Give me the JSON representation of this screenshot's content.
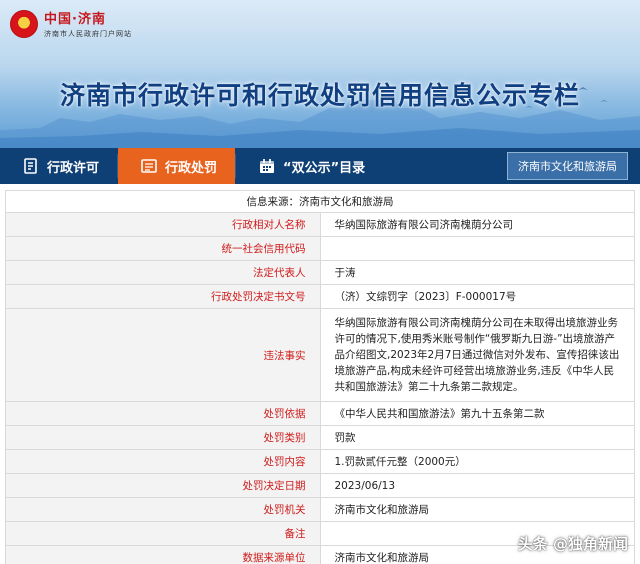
{
  "header": {
    "logo_main": "中国·济南",
    "logo_sub": "济南市人民政府门户网站",
    "title": "济南市行政许可和行政处罚信用信息公示专栏"
  },
  "nav": {
    "items": [
      {
        "label": "行政许可",
        "icon": "document-icon",
        "active": false
      },
      {
        "label": "行政处罚",
        "icon": "list-icon",
        "active": true
      },
      {
        "label": "“双公示”目录",
        "icon": "calendar-icon",
        "active": false
      }
    ],
    "department": "济南市文化和旅游局"
  },
  "record": {
    "source": "信息来源：济南市文化和旅游局",
    "rows": [
      {
        "label": "行政相对人名称",
        "value": "华纳国际旅游有限公司济南槐荫分公司"
      },
      {
        "label": "统一社会信用代码",
        "value": ""
      },
      {
        "label": "法定代表人",
        "value": "于涛"
      },
      {
        "label": "行政处罚决定书文号",
        "value": "（济）文综罚字〔2023〕F-000017号"
      },
      {
        "label": "违法事实",
        "value": "华纳国际旅游有限公司济南槐荫分公司在未取得出境旅游业务许可的情况下,使用秀米账号制作“俄罗斯九日游-”出境旅游产品介绍图文,2023年2月7日通过微信对外发布、宣传招徕该出境旅游产品,构成未经许可经营出境旅游业务,违反《中华人民共和国旅游法》第二十九条第二款规定。"
      },
      {
        "label": "处罚依据",
        "value": "《中华人民共和国旅游法》第九十五条第二款"
      },
      {
        "label": "处罚类别",
        "value": "罚款"
      },
      {
        "label": "处罚内容",
        "value": "1.罚款贰仟元整（2000元）"
      },
      {
        "label": "处罚决定日期",
        "value": "2023/06/13"
      },
      {
        "label": "处罚机关",
        "value": "济南市文化和旅游局"
      },
      {
        "label": "备注",
        "value": ""
      },
      {
        "label": "数据来源单位",
        "value": "济南市文化和旅游局"
      }
    ]
  },
  "watermark": "头条 @独角新闻",
  "colors": {
    "nav_bg": "#0e3f75",
    "nav_active": "#e8631e",
    "label_red": "#d01b1b",
    "title_blue": "#103f82"
  }
}
